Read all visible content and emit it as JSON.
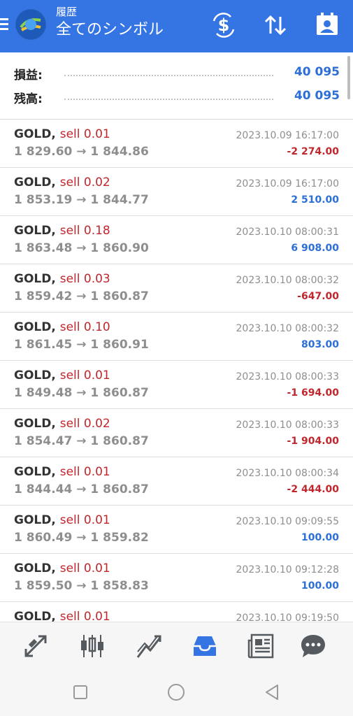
{
  "header": {
    "title_small": "履歴",
    "title_big": "全てのシンボル"
  },
  "colors": {
    "accent": "#3574e3",
    "profit": "#2c6fd6",
    "loss": "#c0272d"
  },
  "summary": {
    "profit_label": "損益:",
    "profit_value": "40 095",
    "balance_label": "残高:",
    "balance_value": "40 095"
  },
  "deals": [
    {
      "symbol": "GOLD,",
      "side": "sell 0.01",
      "prices": "1 829.60 → 1 844.86",
      "time": "2023.10.09 16:17:00",
      "pl": "-2 274.00",
      "type": "loss"
    },
    {
      "symbol": "GOLD,",
      "side": "sell 0.02",
      "prices": "1 853.19 → 1 844.77",
      "time": "2023.10.09 16:17:00",
      "pl": "2 510.00",
      "type": "profit"
    },
    {
      "symbol": "GOLD,",
      "side": "sell 0.18",
      "prices": "1 863.48 → 1 860.90",
      "time": "2023.10.10 08:00:31",
      "pl": "6 908.00",
      "type": "profit"
    },
    {
      "symbol": "GOLD,",
      "side": "sell 0.03",
      "prices": "1 859.42 → 1 860.87",
      "time": "2023.10.10 08:00:32",
      "pl": "-647.00",
      "type": "loss"
    },
    {
      "symbol": "GOLD,",
      "side": "sell 0.10",
      "prices": "1 861.45 → 1 860.91",
      "time": "2023.10.10 08:00:32",
      "pl": "803.00",
      "type": "profit"
    },
    {
      "symbol": "GOLD,",
      "side": "sell 0.01",
      "prices": "1 849.48 → 1 860.87",
      "time": "2023.10.10 08:00:33",
      "pl": "-1 694.00",
      "type": "loss"
    },
    {
      "symbol": "GOLD,",
      "side": "sell 0.02",
      "prices": "1 854.47 → 1 860.87",
      "time": "2023.10.10 08:00:33",
      "pl": "-1 904.00",
      "type": "loss"
    },
    {
      "symbol": "GOLD,",
      "side": "sell 0.01",
      "prices": "1 844.44 → 1 860.87",
      "time": "2023.10.10 08:00:34",
      "pl": "-2 444.00",
      "type": "loss"
    },
    {
      "symbol": "GOLD,",
      "side": "sell 0.01",
      "prices": "1 860.49 → 1 859.82",
      "time": "2023.10.10 09:09:55",
      "pl": "100.00",
      "type": "profit"
    },
    {
      "symbol": "GOLD,",
      "side": "sell 0.01",
      "prices": "1 859.50 → 1 858.83",
      "time": "2023.10.10 09:12:28",
      "pl": "100.00",
      "type": "profit"
    },
    {
      "symbol": "GOLD,",
      "side": "sell 0.01",
      "prices": "",
      "time": "2023.10.10 09:19:50",
      "pl": "",
      "type": "profit"
    }
  ],
  "bottom_nav": [
    {
      "name": "quotes",
      "icon": "arrows-diagonal-icon",
      "active": false
    },
    {
      "name": "chart",
      "icon": "candlestick-icon",
      "active": false
    },
    {
      "name": "trade",
      "icon": "trend-lines-icon",
      "active": false
    },
    {
      "name": "history",
      "icon": "inbox-tray-icon",
      "active": true
    },
    {
      "name": "news",
      "icon": "newspaper-icon",
      "active": false
    },
    {
      "name": "messages",
      "icon": "chat-bubble-icon",
      "active": false
    }
  ]
}
